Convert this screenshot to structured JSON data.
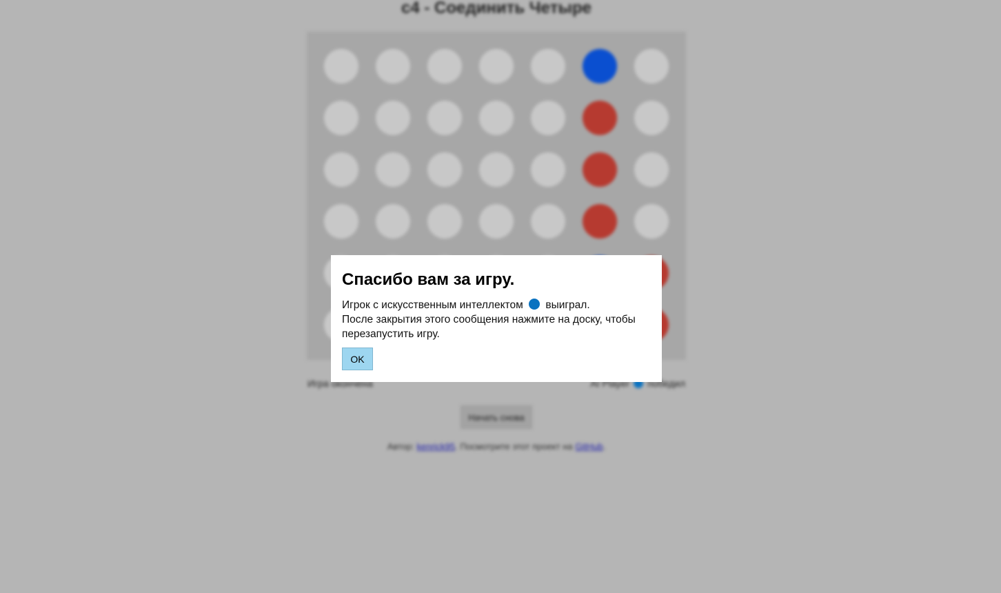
{
  "page": {
    "title": "c4 - Соединить Четыре",
    "status_left": "Игра окончена",
    "status_right_prefix": "AI Player",
    "status_right_suffix": "победил",
    "reset_label": "Начать снова",
    "footer_text": "Автор: ",
    "footer_author": "kenrick95",
    "footer_middle": ". Посмотрите этот проект на ",
    "footer_link": "GitHub",
    "footer_end": "."
  },
  "board": {
    "columns": 7,
    "rows": 6,
    "colors": {
      "empty": "#c8c8c8",
      "red": "#b63a30",
      "blue": "#0a4fd0"
    },
    "cells": [
      [
        "empty",
        "empty",
        "empty",
        "empty",
        "empty",
        "blue",
        "empty"
      ],
      [
        "empty",
        "empty",
        "empty",
        "empty",
        "empty",
        "red",
        "empty"
      ],
      [
        "empty",
        "empty",
        "empty",
        "empty",
        "empty",
        "red",
        "empty"
      ],
      [
        "empty",
        "empty",
        "empty",
        "empty",
        "empty",
        "red",
        "empty"
      ],
      [
        "empty",
        "empty",
        "empty",
        "empty",
        "empty",
        "blue",
        "red"
      ],
      [
        "empty",
        "empty",
        "empty",
        "empty",
        "empty",
        "blue",
        "red"
      ]
    ]
  },
  "dialog": {
    "title": "Спасибо вам за игру.",
    "line1_before": "Игрок с искусственным интеллектом",
    "line1_after": "выиграл.",
    "line2": "После закрытия этого сообщения нажмите на доску, чтобы перезапустить игру.",
    "ok_label": "OK",
    "winner_color": "#0a72c0",
    "ok_color": "#9dd6f0"
  }
}
